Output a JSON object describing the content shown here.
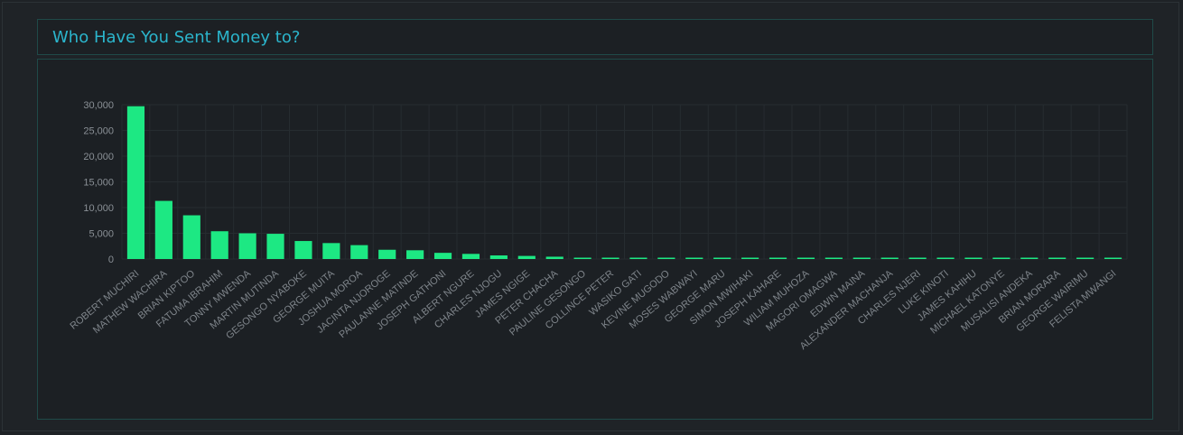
{
  "header": {
    "title": "Who Have You Sent Money to?"
  },
  "colors": {
    "bar": "#1de883",
    "title": "#2bb5cc",
    "grid": "#262c30",
    "border": "#1f4a48",
    "background": "#1c2024"
  },
  "chart_data": {
    "type": "bar",
    "title": "",
    "xlabel": "",
    "ylabel": "",
    "ylim": [
      0,
      30000
    ],
    "yticks": [
      0,
      5000,
      10000,
      15000,
      20000,
      25000,
      30000
    ],
    "ytick_labels": [
      "0",
      "5,000",
      "10,000",
      "15,000",
      "20,000",
      "25,000",
      "30,000"
    ],
    "grid": true,
    "legend": "none",
    "categories": [
      "ROBERT MUCHIRI",
      "MATHEW WACHIRA",
      "BRIAN KIPTOO",
      "FATUMA IBRAHIM",
      "TONNY MWENDA",
      "MARTIN MUTINDA",
      "GESONGO NYABOKE",
      "GEORGE MUITA",
      "JOSHUA MOROA",
      "JACINTA NJOROGE",
      "PAULANNE MATINDE",
      "JOSEPH GATHONI",
      "ALBERT NGURE",
      "CHARLES NJOGU",
      "JAMES NGIGE",
      "PETER CHACHA",
      "PAULINE GESONGO",
      "COLLINCE PETER",
      "WASIKO GATI",
      "KEVINE MUGODO",
      "MOSES WABWAYI",
      "GEORGE MARU",
      "SIMON MWIHAKI",
      "JOSEPH KAHARE",
      "WILIAM MUHOZA",
      "MAGORI OMAGWA",
      "EDWIN MAINA",
      "ALEXANDER MACHANJA",
      "CHARLES NJERI",
      "LUKE KINOTI",
      "JAMES KAHIHU",
      "MICHAEL KATONYE",
      "MUSALISI ANDEKA",
      "BRIAN MORARA",
      "GEORGE WAIRIMU",
      "FELISTA MWANGI"
    ],
    "values": [
      29700,
      11300,
      8500,
      5400,
      5000,
      4900,
      3500,
      3100,
      2700,
      1800,
      1700,
      1200,
      1000,
      700,
      600,
      450,
      200,
      150,
      130,
      110,
      100,
      90,
      80,
      70,
      60,
      55,
      50,
      45,
      40,
      35,
      30,
      30,
      25,
      20,
      15,
      10
    ]
  }
}
